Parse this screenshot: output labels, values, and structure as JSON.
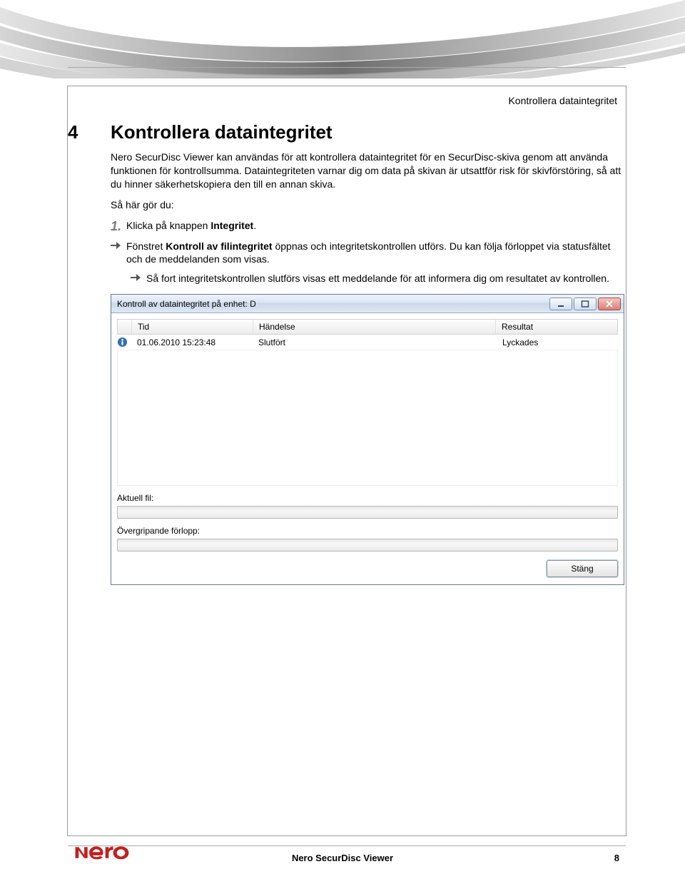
{
  "running_head": "Kontrollera dataintegritet",
  "section": {
    "number": "4",
    "title": "Kontrollera dataintegritet",
    "para1": "Nero SecurDisc Viewer kan användas för att kontrollera dataintegritet för en SecurDisc-skiva genom att använda funktionen för kontrollsumma. Dataintegriteten varnar dig om data på skivan är utsattför risk för skivförstöring, så att du hinner säkerhetskopiera den till en annan skiva.",
    "so_here": "Så här gör du:",
    "step1_prefix": "Klicka på knappen ",
    "step1_bold": "Integritet",
    "step1_suffix": ".",
    "arrow1_prefix": "Fönstret ",
    "arrow1_bold": "Kontroll av filintegritet",
    "arrow1_suffix": " öppnas och integritetskontrollen utförs. Du kan följa förloppet via statusfältet och de meddelanden som visas.",
    "arrow2": "Så fort integritetskontrollen slutförs visas ett meddelande för att informera dig om resultatet av kontrollen."
  },
  "dialog": {
    "title": "Kontroll av dataintegritet på enhet: D",
    "columns": {
      "tid": "Tid",
      "handelse": "Händelse",
      "resultat": "Resultat"
    },
    "row": {
      "tid": "01.06.2010 15:23:48",
      "handelse": "Slutfört",
      "resultat": "Lyckades"
    },
    "aktuell_fil": "Aktuell fil:",
    "overgripande": "Övergripande förlopp:",
    "close_label": "Stäng"
  },
  "footer": {
    "center": "Nero SecurDisc Viewer",
    "page": "8"
  }
}
